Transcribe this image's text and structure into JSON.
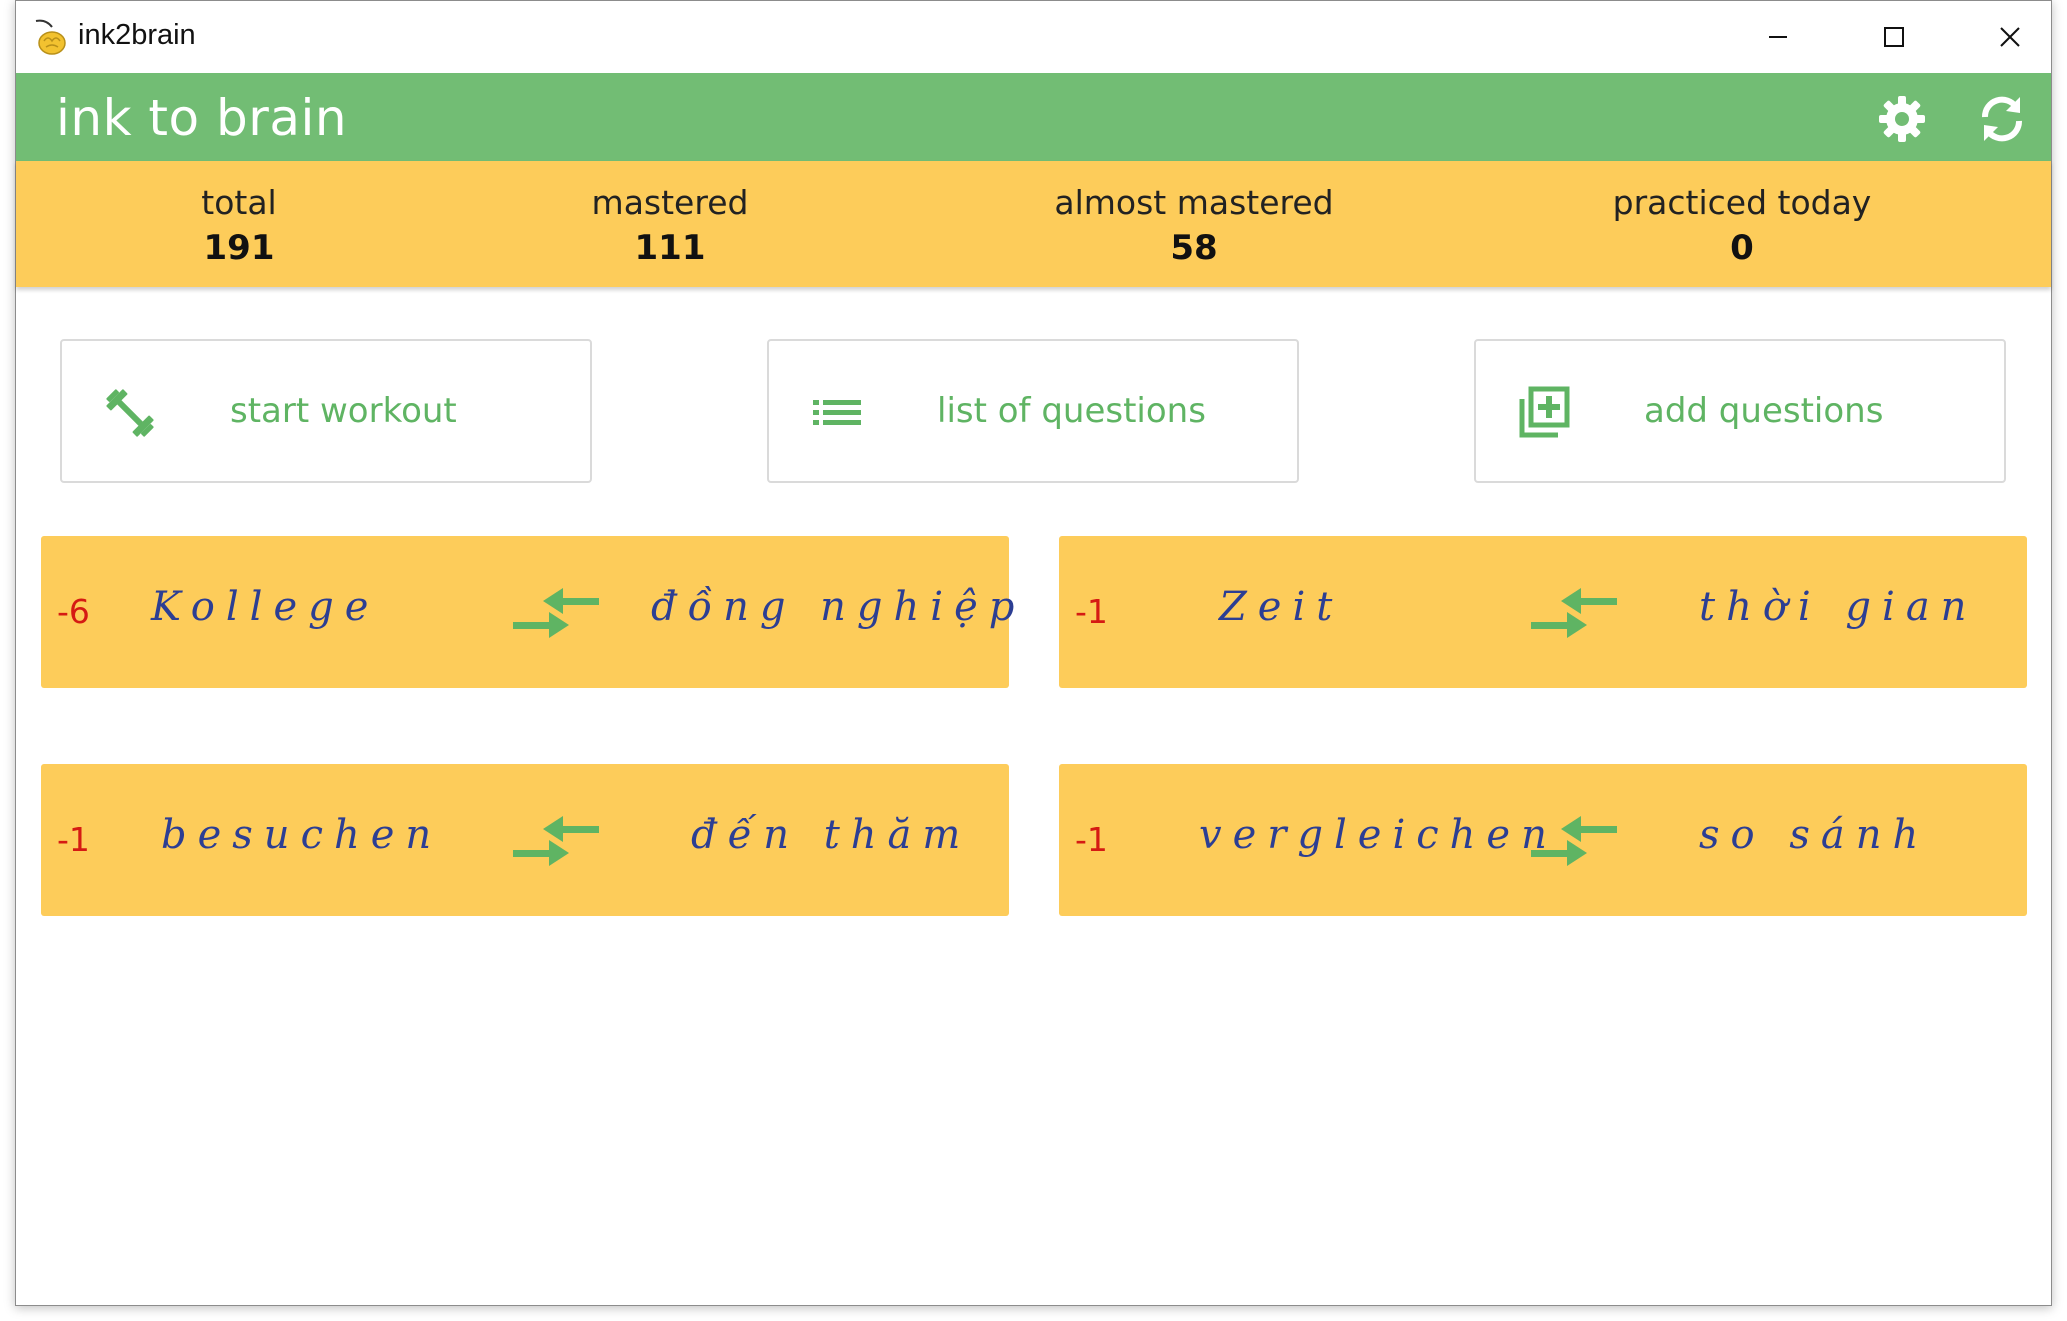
{
  "window": {
    "title": "ink2brain"
  },
  "header": {
    "title": "ink to brain",
    "icons": [
      "gear-icon",
      "sync-icon"
    ]
  },
  "stats": [
    {
      "label": "total",
      "value": "191"
    },
    {
      "label": "mastered",
      "value": "111"
    },
    {
      "label": "almost mastered",
      "value": "58"
    },
    {
      "label": "practiced today",
      "value": "0"
    }
  ],
  "actions": [
    {
      "label": "start workout",
      "icon": "dumbbell-icon"
    },
    {
      "label": "list of questions",
      "icon": "list-icon"
    },
    {
      "label": "add questions",
      "icon": "add-to-library-icon"
    }
  ],
  "cards": [
    {
      "score": "-6",
      "front": "Kollege",
      "back": "đồng nghiệp"
    },
    {
      "score": "-1",
      "front": "Zeit",
      "back": "thời gian"
    },
    {
      "score": "-1",
      "front": "besuchen",
      "back": "đến thăm"
    },
    {
      "score": "-1",
      "front": "vergleichen",
      "back": "so sánh"
    }
  ],
  "colors": {
    "header_green": "#72bd74",
    "accent_yellow": "#fdcc5a",
    "action_text_green": "#5fb463",
    "score_red": "#d51a13",
    "ink_blue": "#2c3e93"
  }
}
